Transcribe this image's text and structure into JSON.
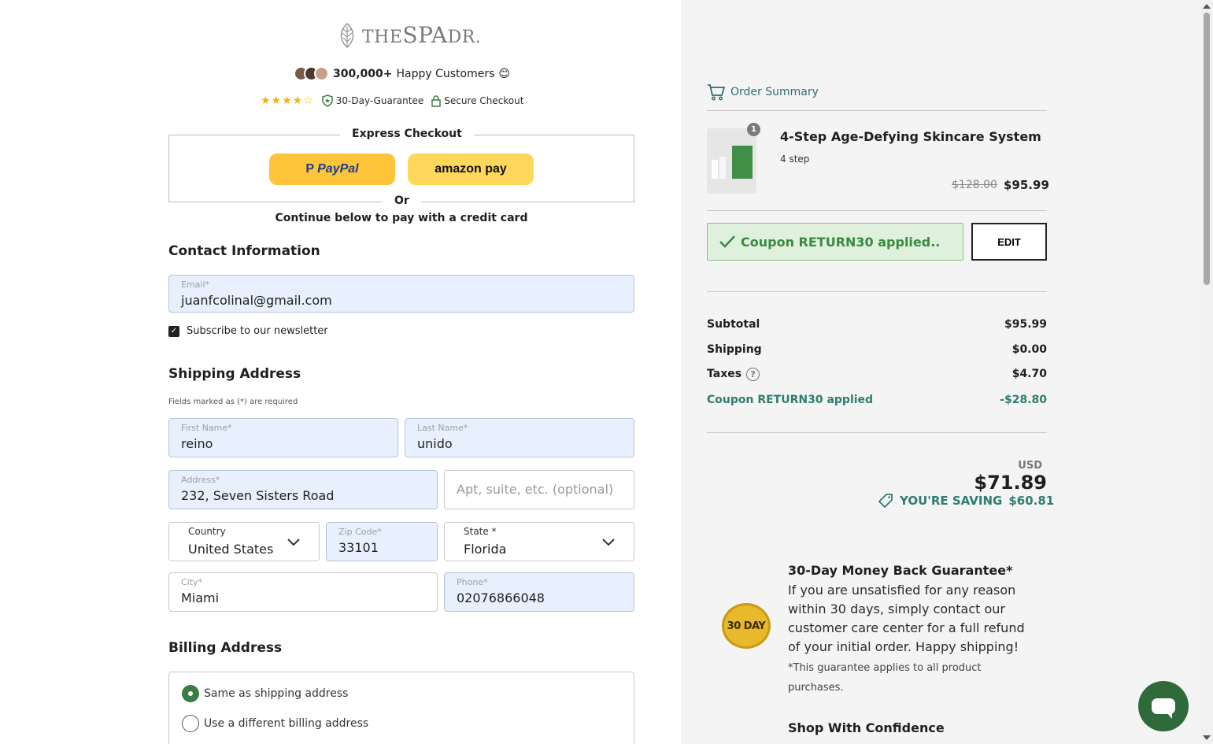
{
  "header": {
    "logo_text_the": "THE",
    "logo_text_spa": "SPA",
    "logo_text_dr": "DR.",
    "customers_count": "300,000+",
    "customers_label": "Happy Customers",
    "customers_emoji": "😊",
    "guarantee_label": "30-Day-Guarantee",
    "secure_label": "Secure Checkout"
  },
  "express": {
    "title": "Express Checkout",
    "paypal_label": "PayPal",
    "amazon_label": "amazon pay",
    "or_label": "Or",
    "continue_label": "Continue below to pay with a credit card"
  },
  "contact": {
    "title": "Contact Information",
    "email_label": "Email*",
    "email_value": "juanfcolinal@gmail.com",
    "newsletter_label": "Subscribe to our newsletter"
  },
  "shipping": {
    "title": "Shipping Address",
    "required_note": "Fields marked as (*) are required",
    "first_name_label": "First Name*",
    "first_name_value": "reino",
    "last_name_label": "Last Name*",
    "last_name_value": "unido",
    "address_label": "Address*",
    "address_value": "232, Seven Sisters Road",
    "apt_placeholder": "Apt, suite, etc. (optional)",
    "country_label": "Country",
    "country_value": "United States",
    "zip_label": "Zip Code*",
    "zip_value": "33101",
    "state_label": "State *",
    "state_value": "Florida",
    "city_label": "City*",
    "city_value": "Miami",
    "phone_label": "Phone*",
    "phone_value": "02076866048"
  },
  "billing": {
    "title": "Billing Address",
    "option_same": "Same as shipping address",
    "option_different": "Use a different billing address"
  },
  "summary": {
    "title": "Order Summary",
    "item_qty": "1",
    "item_name": "4-Step Age-Defying Skincare System",
    "item_variant": "4 step",
    "item_old_price": "$128.00",
    "item_price": "$95.99",
    "coupon_applied_text": "Coupon RETURN30 applied..",
    "edit_label": "EDIT",
    "subtotal_label": "Subtotal",
    "subtotal_value": "$95.99",
    "shipping_label": "Shipping",
    "shipping_value": "$0.00",
    "taxes_label": "Taxes",
    "taxes_value": "$4.70",
    "coupon_label": "Coupon RETURN30 applied",
    "coupon_value": "-$28.80",
    "total_currency": "USD",
    "total_value": "$71.89",
    "saving_label": "YOU'RE SAVING",
    "saving_value": "$60.81"
  },
  "guarantee": {
    "badge_text": "30 DAY",
    "title": "30-Day Money Back Guarantee*",
    "body": "If you are unsatisfied for any reason within 30 days, simply contact our customer care center for a full refund of your initial order. Happy shipping!",
    "note": "*This guarantee applies to all product purchases.",
    "shop_title": "Shop With Confidence"
  },
  "colors": {
    "accent_green": "#3a7d44",
    "teal": "#2e7d6f",
    "autofill_blue": "#e8f0fe",
    "paypal_yellow": "#ffc439"
  }
}
